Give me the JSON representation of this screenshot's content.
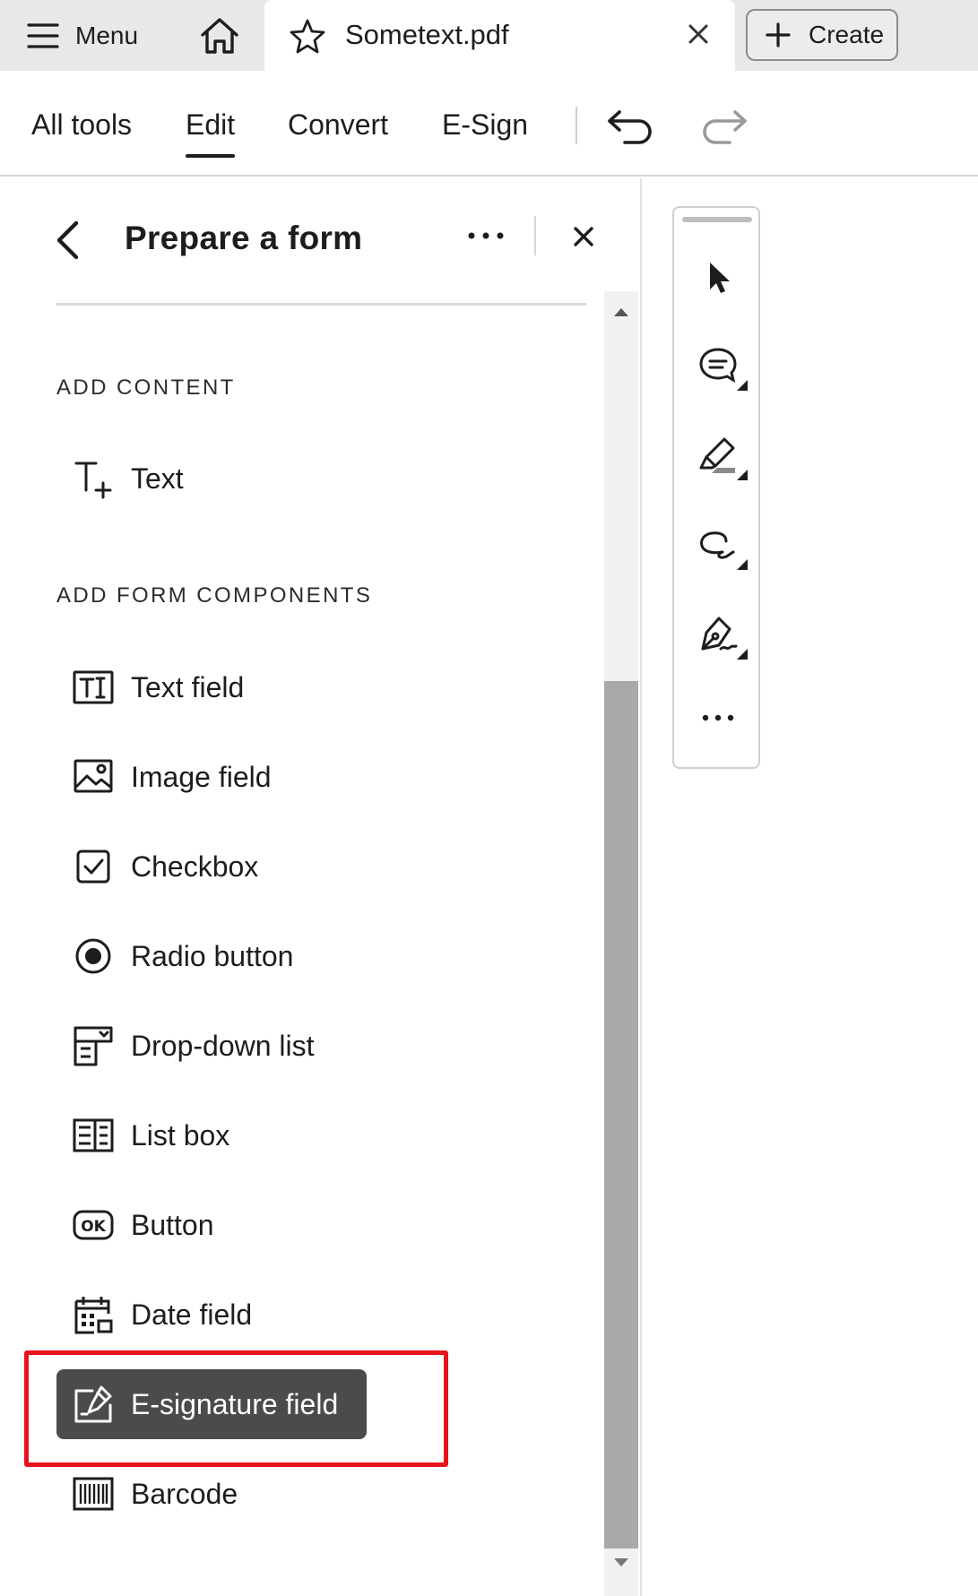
{
  "tabbar": {
    "menu_label": "Menu",
    "document_name": "Sometext.pdf",
    "create_label": "Create"
  },
  "toolbar": {
    "tabs": [
      {
        "label": "All tools"
      },
      {
        "label": "Edit",
        "active": true
      },
      {
        "label": "Convert"
      },
      {
        "label": "E-Sign"
      }
    ]
  },
  "panel": {
    "title": "Prepare a form",
    "sections": {
      "add_content": "ADD CONTENT",
      "add_form_components": "ADD FORM COMPONENTS"
    },
    "content_items": [
      {
        "label": "Text",
        "icon": "text-add-icon"
      }
    ],
    "form_items": [
      {
        "label": "Text field",
        "icon": "text-field-icon"
      },
      {
        "label": "Image field",
        "icon": "image-field-icon"
      },
      {
        "label": "Checkbox",
        "icon": "checkbox-icon"
      },
      {
        "label": "Radio button",
        "icon": "radio-button-icon"
      },
      {
        "label": "Drop-down list",
        "icon": "dropdown-list-icon"
      },
      {
        "label": "List box",
        "icon": "list-box-icon"
      },
      {
        "label": "Button",
        "icon": "ok-button-icon"
      },
      {
        "label": "Date field",
        "icon": "calendar-icon"
      },
      {
        "label": "E-signature field",
        "icon": "e-signature-icon",
        "selected": true
      },
      {
        "label": "Barcode",
        "icon": "barcode-icon"
      }
    ]
  },
  "float_toolbar": {
    "tools": [
      "select-pointer-icon",
      "comment-icon",
      "highlight-icon",
      "draw-freeform-icon",
      "sign-pen-icon",
      "more-tools-icon"
    ]
  },
  "colors": {
    "selected_bg": "#4b4b4b",
    "highlight_outline": "#e8131b",
    "scroll_thumb": "#a9a9a9"
  }
}
